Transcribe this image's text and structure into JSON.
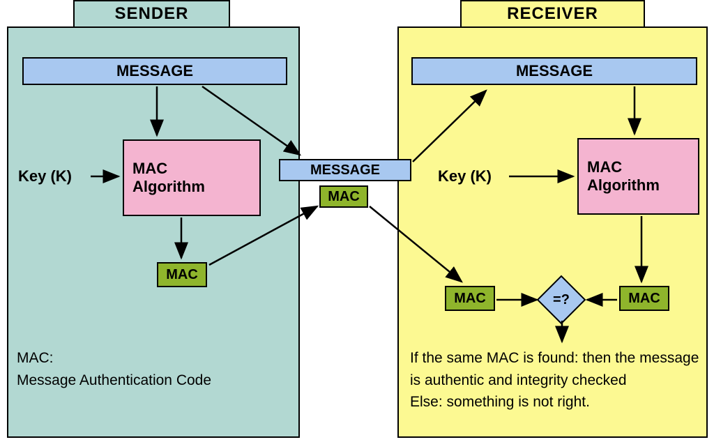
{
  "sender": {
    "header": "SENDER",
    "message": "MESSAGE",
    "key": "Key (K)",
    "algo_line1": "MAC",
    "algo_line2": "Algorithm",
    "mac": "MAC",
    "note_line1": "MAC:",
    "note_line2": "Message Authentication Code"
  },
  "receiver": {
    "header": "RECEIVER",
    "message": "MESSAGE",
    "key": "Key (K)",
    "algo_line1": "MAC",
    "algo_line2": "Algorithm",
    "mac_left": "MAC",
    "mac_right": "MAC",
    "compare": "=?",
    "note": "If the same MAC is found: then the message is authentic and integrity checked\nElse: something is not right."
  },
  "channel": {
    "message": "MESSAGE",
    "mac": "MAC"
  }
}
